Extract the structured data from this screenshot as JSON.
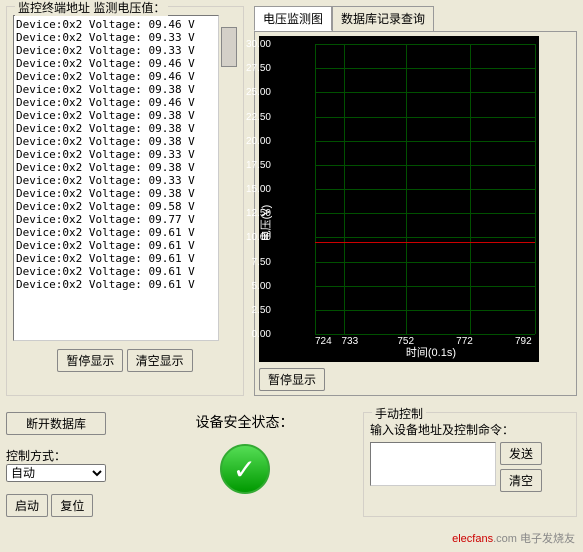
{
  "log_panel": {
    "title": "监控终端地址 监测电压值：",
    "rows": [
      "Device:0x2 Voltage: 09.46 V",
      "Device:0x2 Voltage: 09.33 V",
      "Device:0x2 Voltage: 09.33 V",
      "Device:0x2 Voltage: 09.46 V",
      "Device:0x2 Voltage: 09.46 V",
      "Device:0x2 Voltage: 09.38 V",
      "Device:0x2 Voltage: 09.46 V",
      "Device:0x2 Voltage: 09.38 V",
      "Device:0x2 Voltage: 09.38 V",
      "Device:0x2 Voltage: 09.38 V",
      "Device:0x2 Voltage: 09.33 V",
      "Device:0x2 Voltage: 09.38 V",
      "Device:0x2 Voltage: 09.33 V",
      "Device:0x2 Voltage: 09.38 V",
      "Device:0x2 Voltage: 09.58 V",
      "Device:0x2 Voltage: 09.77 V",
      "Device:0x2 Voltage: 09.61 V",
      "Device:0x2 Voltage: 09.61 V",
      "Device:0x2 Voltage: 09.61 V",
      "Device:0x2 Voltage: 09.61 V",
      "Device:0x2 Voltage: 09.61 V"
    ],
    "pause_btn": "暂停显示",
    "clear_btn": "清空显示"
  },
  "tabs": {
    "chart": "电压监测图",
    "db": "数据库记录查询"
  },
  "chart_data": {
    "type": "line",
    "title": "",
    "xlabel": "时间(0.1s)",
    "ylabel": "电压(V)",
    "ylim": [
      0,
      30
    ],
    "y_ticks": [
      30.0,
      27.5,
      25.0,
      22.5,
      20.0,
      17.5,
      15.0,
      12.5,
      10.0,
      7.5,
      5.0,
      2.5,
      0.0
    ],
    "x_ticks": [
      724,
      733,
      752,
      772,
      792
    ],
    "series": [
      {
        "name": "电压",
        "color": "#c00",
        "approx_value": 9.5
      }
    ]
  },
  "chart_controls": {
    "pause_btn": "暂停显示"
  },
  "bottom": {
    "disconnect_btn": "断开数据库",
    "status_label": "设备安全状态：",
    "control_mode_label": "控制方式：",
    "control_mode_value": "自动",
    "start_btn": "启动",
    "reset_btn": "复位",
    "manual_group": "手动控制",
    "manual_prompt": "输入设备地址及控制命令：",
    "send_btn": "发送",
    "clear_btn": "清空"
  },
  "footer": {
    "elecfans": "elecfans",
    "com": ".com",
    "cn": "电子发烧友"
  }
}
